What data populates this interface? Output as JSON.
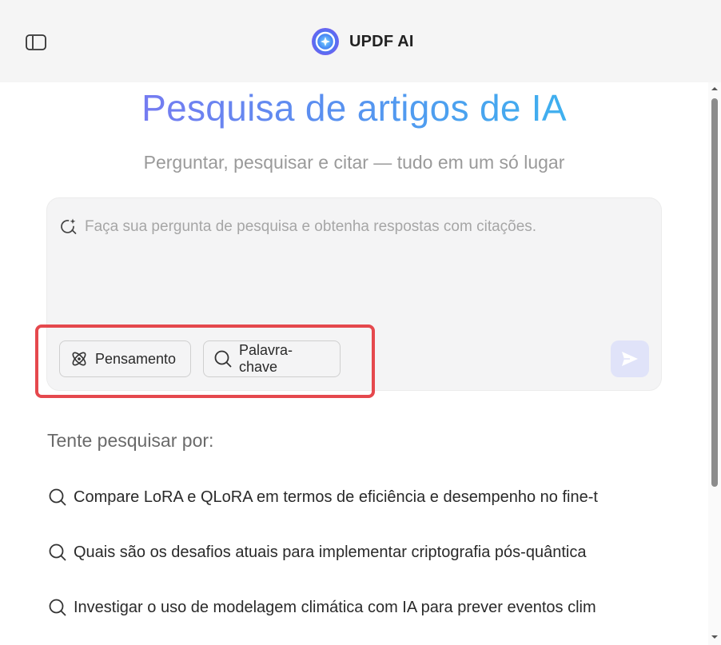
{
  "header": {
    "app_name": "UPDF AI",
    "icons": {
      "sidebar_toggle": "sidebar-toggle-icon",
      "logo": "updf-ai-logo"
    }
  },
  "main": {
    "title": "Pesquisa de artigos de IA",
    "subtitle": "Perguntar, pesquisar e citar — tudo em um só lugar"
  },
  "search": {
    "placeholder": "Faça sua pergunta de pesquisa e obtenha respostas com citações.",
    "value": "",
    "chips": [
      {
        "label": "Pensamento",
        "icon": "atom-icon"
      },
      {
        "label": "Palavra-chave",
        "icon": "search-icon"
      }
    ],
    "send_icon": "send-icon"
  },
  "suggestions": {
    "heading": "Tente pesquisar por:",
    "items": [
      "Compare LoRA e QLoRA em termos de eficiência e desempenho no fine-t",
      "Quais são os desafios atuais para implementar criptografia pós-quântica",
      "Investigar o uso de modelagem climática com IA para prever eventos clim"
    ]
  },
  "colors": {
    "title_gradient_start": "#8a6cf2",
    "title_gradient_end": "#2ec3ee",
    "highlight": "#e5484d",
    "send_button_bg": "#e0e3f9"
  }
}
